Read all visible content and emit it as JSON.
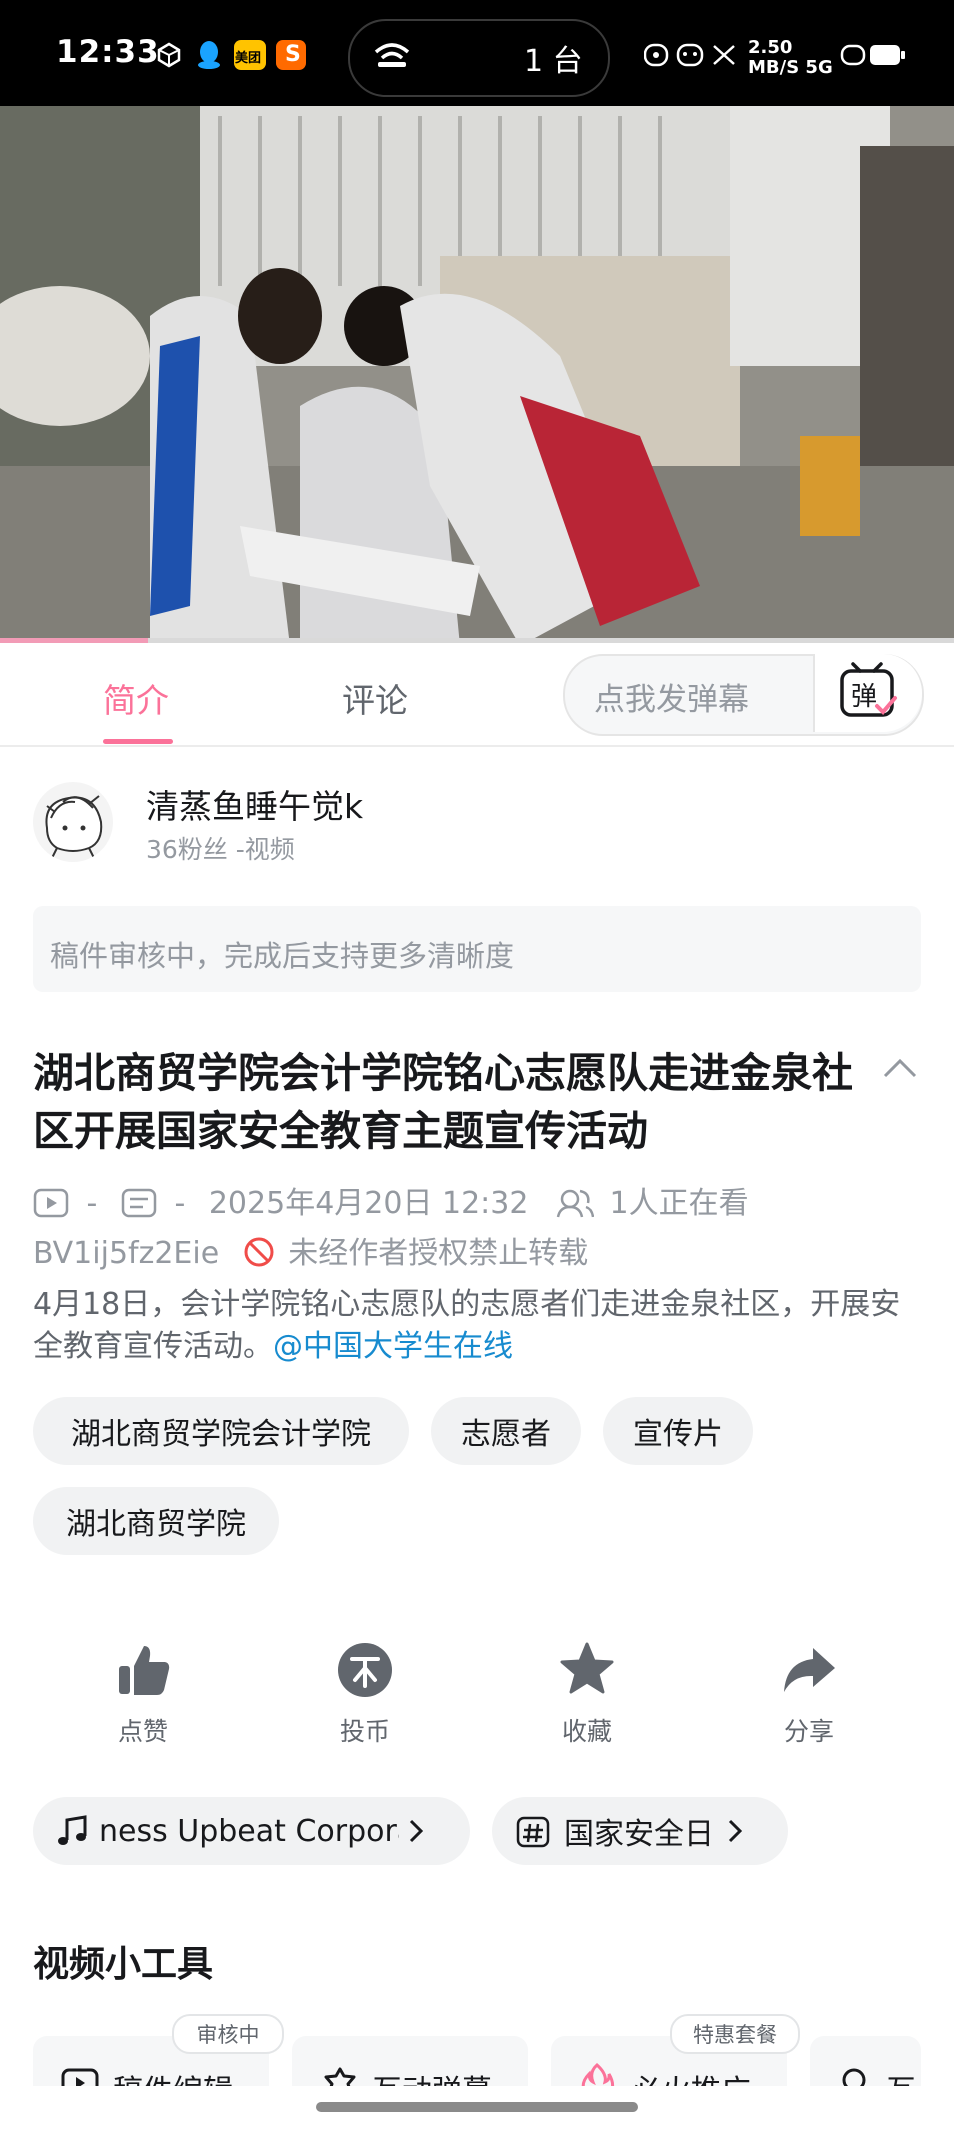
{
  "status_bar": {
    "time": "12:33",
    "apps": [
      "meituan",
      "taobao"
    ],
    "island_text": "1 台",
    "right_text": "2.50 MB/S  5G"
  },
  "video": {
    "progress_fraction": 0.155
  },
  "tabs": [
    {
      "label": "简介",
      "active": true
    },
    {
      "label": "评论",
      "active": false
    }
  ],
  "danmaku": {
    "placeholder": "点我发弹幕",
    "button": "弹"
  },
  "author": {
    "name": "清蒸鱼睡午觉k",
    "meta": "36粉丝    -视频"
  },
  "notice": "稿件审核中，完成后支持更多清晰度",
  "video_info": {
    "title": "湖北商贸学院会计学院铭心志愿队走进金泉社区开展国家安全教育主题宣传活动",
    "plays": "-",
    "danmaku_count": "-",
    "date": "2025年4月20日 12:32",
    "watching": "1人正在看",
    "bvid": "BV1ij5fz2Eie",
    "copyright": "未经作者授权禁止转载",
    "description": "4月18日，会计学院铭心志愿队的志愿者们走进金泉社区，开展安全教育宣传活动。",
    "mention": "@中国大学生在线"
  },
  "tags": [
    "湖北商贸学院会计学院",
    "志愿者",
    "宣传片",
    "湖北商贸学院"
  ],
  "actions": [
    {
      "label": "点赞",
      "icon": "thumbs-up-icon"
    },
    {
      "label": "投币",
      "icon": "coin-icon"
    },
    {
      "label": "收藏",
      "icon": "star-icon"
    },
    {
      "label": "分享",
      "icon": "share-icon"
    }
  ],
  "music": "ness Upbeat Corpora",
  "topic": "国家安全日",
  "tools_section_title": "视频小工具",
  "tools": [
    {
      "label": "稿件编辑",
      "badge": "审核中"
    },
    {
      "label": "互动弹幕",
      "badge": ""
    },
    {
      "label": "必火推广",
      "badge": "特惠套餐"
    },
    {
      "label": "互",
      "badge": ""
    }
  ],
  "colors": {
    "accent": "#fb7299",
    "link": "#178bcf",
    "muted": "#9499a0"
  }
}
